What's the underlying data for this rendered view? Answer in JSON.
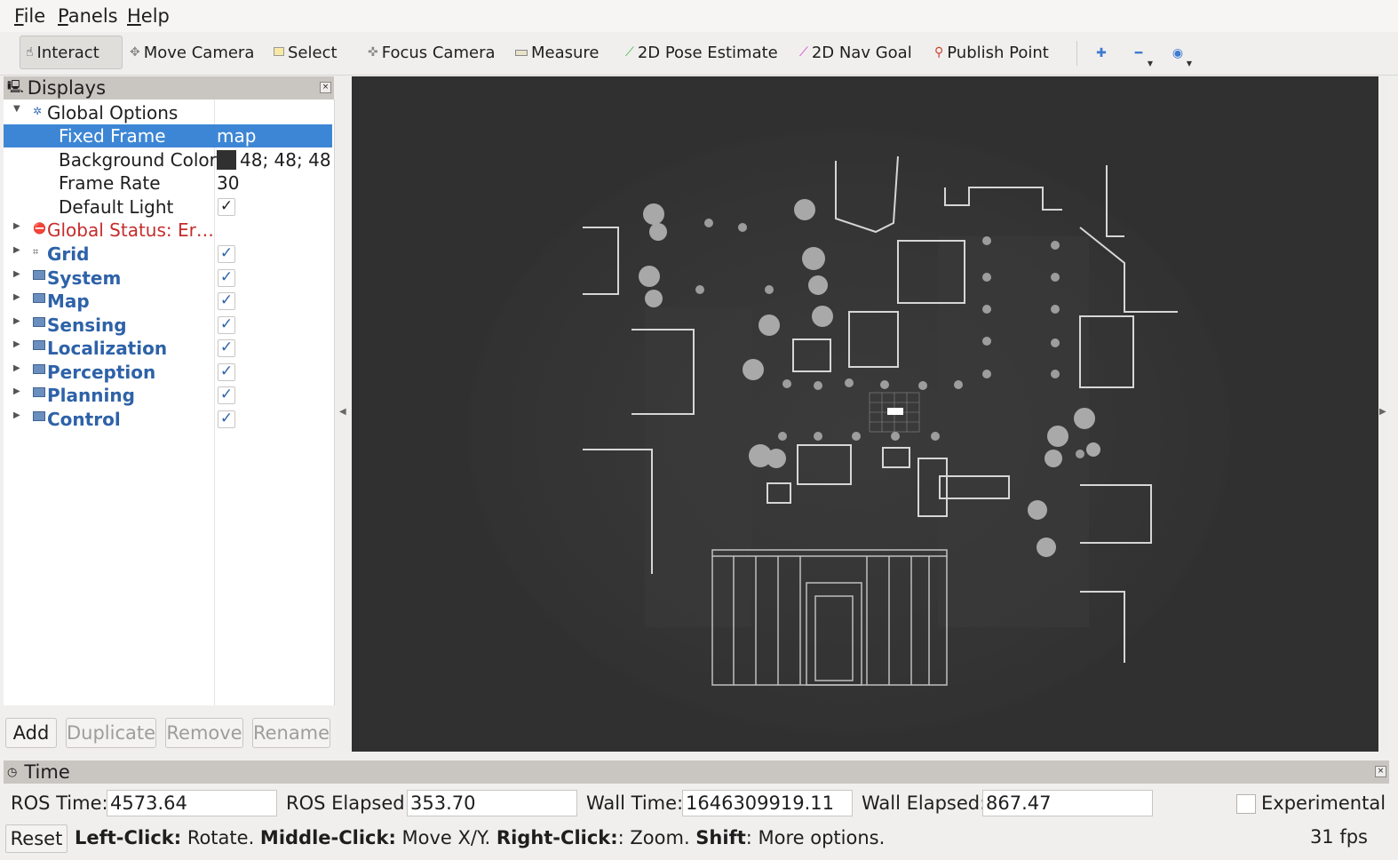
{
  "menu": {
    "file": {
      "accel": "F",
      "rest": "ile"
    },
    "panels": {
      "accel": "P",
      "rest": "anels"
    },
    "help": {
      "accel": "H",
      "rest": "elp"
    }
  },
  "toolbar": {
    "interact": "Interact",
    "move_camera": "Move Camera",
    "select": "Select",
    "focus_camera": "Focus Camera",
    "measure": "Measure",
    "pose_estimate": "2D Pose Estimate",
    "nav_goal": "2D Nav Goal",
    "publish_point": "Publish Point",
    "active_tool": "Interact"
  },
  "displays": {
    "title": "Displays",
    "global_options": {
      "label": "Global Options",
      "fixed_frame": {
        "label": "Fixed Frame",
        "value": "map"
      },
      "background_color": {
        "label": "Background Color",
        "value": "48; 48; 48",
        "swatch": "#303030"
      },
      "frame_rate": {
        "label": "Frame Rate",
        "value": "30"
      },
      "default_light": {
        "label": "Default Light",
        "checked": true
      }
    },
    "global_status": {
      "label": "Global Status: Er…",
      "color": "#c52c2c"
    },
    "items": [
      {
        "label": "Grid",
        "checked": true
      },
      {
        "label": "System",
        "checked": true
      },
      {
        "label": "Map",
        "checked": true
      },
      {
        "label": "Sensing",
        "checked": true
      },
      {
        "label": "Localization",
        "checked": true
      },
      {
        "label": "Perception",
        "checked": true
      },
      {
        "label": "Planning",
        "checked": true
      },
      {
        "label": "Control",
        "checked": true
      }
    ],
    "buttons": {
      "add": "Add",
      "duplicate": "Duplicate",
      "remove": "Remove",
      "rename": "Rename"
    }
  },
  "viewport": {
    "background": "#303030"
  },
  "time": {
    "title": "Time",
    "ros_time_label": "ROS Time:",
    "ros_time": "4573.64",
    "ros_elapsed_label": "ROS Elapsed:",
    "ros_elapsed": "353.70",
    "wall_time_label": "Wall Time:",
    "wall_time": "1646309919.11",
    "wall_elapsed_label": "Wall Elapsed:",
    "wall_elapsed": "867.47",
    "experimental_label": "Experimental",
    "experimental_checked": false
  },
  "status": {
    "reset": "Reset",
    "left_click": "Left-Click:",
    "rotate": " Rotate. ",
    "middle_click": "Middle-Click:",
    "move": " Move X/Y. ",
    "right_click": "Right-Click:",
    "zoom": ": Zoom. ",
    "shift": "Shift",
    "more": ": More options.",
    "fps": "31 fps"
  }
}
